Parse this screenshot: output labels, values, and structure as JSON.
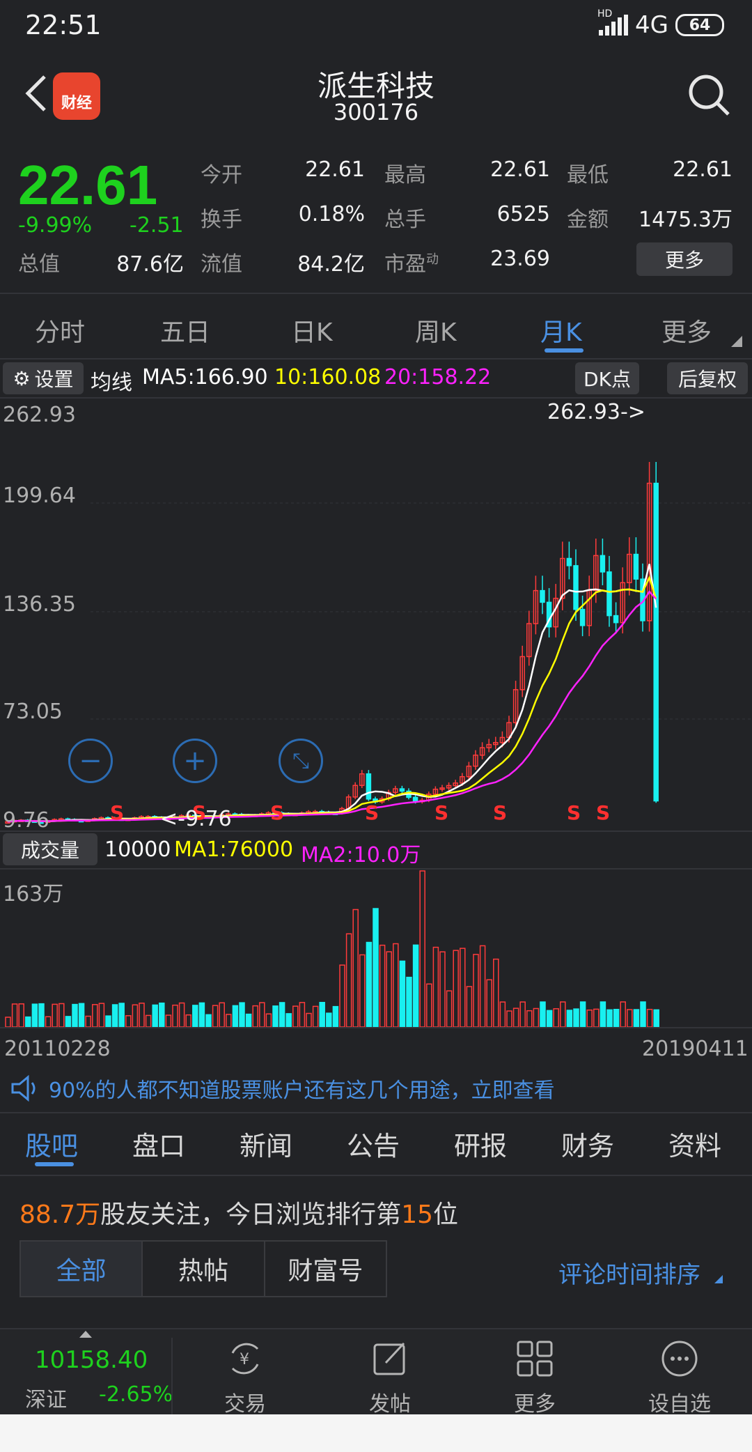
{
  "status": {
    "time": "22:51",
    "network": "4G",
    "battery": "64",
    "hd": "HD"
  },
  "header": {
    "logo_text": "财经",
    "title": "派生科技",
    "code": "300176"
  },
  "quote": {
    "price": "22.61",
    "change_pct": "-9.99%",
    "change": "-2.51",
    "fields": [
      {
        "label": "今开",
        "value": "22.61",
        "green": true
      },
      {
        "label": "最高",
        "value": "22.61",
        "green": true
      },
      {
        "label": "最低",
        "value": "22.61",
        "green": true
      },
      {
        "label": "换手",
        "value": "0.18%"
      },
      {
        "label": "总手",
        "value": "6525"
      },
      {
        "label": "金额",
        "value": "1475.3万"
      },
      {
        "label": "总值",
        "value": "87.6亿"
      },
      {
        "label": "流值",
        "value": "84.2亿"
      },
      {
        "label": "市盈",
        "sup": "动",
        "value": "23.69"
      }
    ],
    "more": "更多"
  },
  "tabs": [
    "分时",
    "五日",
    "日K",
    "周K",
    "月K",
    "更多"
  ],
  "active_tab": 4,
  "indicators": {
    "settings": "设置",
    "ma_label": "均线",
    "ma5": "MA5:166.90",
    "ma10": "10:160.08",
    "ma20": "20:158.22",
    "dk": "DK点",
    "adjust": "后复权",
    "colors": {
      "ma5": "#ffffff",
      "ma10": "#ffff00",
      "ma20": "#ff22ff",
      "up": "#ff3b3b",
      "down": "#19f0f0"
    }
  },
  "chart_data": {
    "type": "candlestick",
    "y_ticks": [
      "262.93",
      "199.64",
      "136.35",
      "73.05",
      "9.76"
    ],
    "ylim": [
      9.76,
      262.93
    ],
    "high_label": "262.93->",
    "low_label": "<-9.76",
    "signal_label": "S",
    "x_start": "20110228",
    "x_end": "20190411",
    "volume": {
      "label": "成交量",
      "v": "10000",
      "ma1": "MA1:76000",
      "ma2": "MA2:10.0万",
      "max_label": "163万"
    }
  },
  "banner": "90%的人都不知道股票账户还有这几个用途，立即查看",
  "bottom_tabs": [
    "股吧",
    "盘口",
    "新闻",
    "公告",
    "研报",
    "财务",
    "资料"
  ],
  "follow": {
    "count": "88.7万",
    "text1": "股友关注，今日浏览排行第",
    "rank": "15",
    "text2": "位"
  },
  "segments": [
    "全部",
    "热帖",
    "财富号"
  ],
  "sort": "评论时间排序",
  "bottom_nav": {
    "index_value": "10158.40",
    "index_name": "深证",
    "index_change": "-2.65%",
    "items": [
      "交易",
      "发帖",
      "更多",
      "设自选"
    ]
  }
}
